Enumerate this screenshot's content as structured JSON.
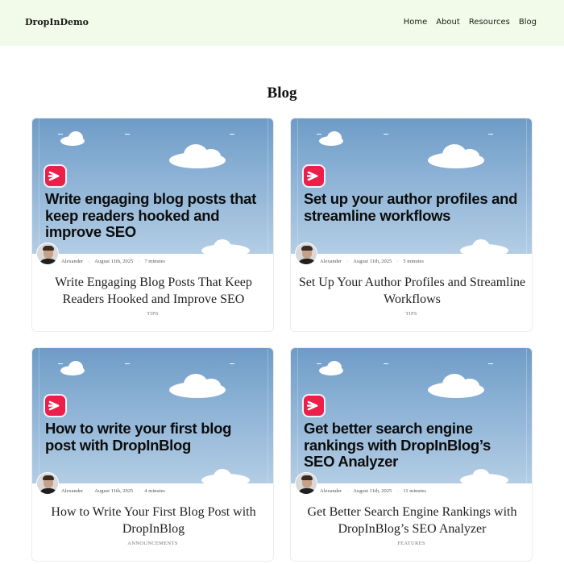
{
  "header": {
    "brand": "DropInDemo",
    "nav": [
      "Home",
      "About",
      "Resources",
      "Blog"
    ]
  },
  "page": {
    "title": "Blog"
  },
  "posts": [
    {
      "hero_headline": "Write engaging blog posts that keep readers hooked and improve SEO",
      "author": "Alexander",
      "date": "August 11th, 2025",
      "read_time": "7 minutes",
      "title": "Write Engaging Blog Posts That Keep Readers Hooked and Improve SEO",
      "category": "TIPS"
    },
    {
      "hero_headline": "Set up your author profiles and streamline workflows",
      "author": "Alexander",
      "date": "August 11th, 2025",
      "read_time": "5 minutes",
      "title": "Set Up Your Author Profiles and Streamline Workflows",
      "category": "TIPS"
    },
    {
      "hero_headline": "How to write your first blog post with DropInBlog",
      "author": "Alexander",
      "date": "August 11th, 2025",
      "read_time": "4 minutes",
      "title": "How to Write Your First Blog Post with DropInBlog",
      "category": "ANNOUNCEMENTS"
    },
    {
      "hero_headline": "Get better search engine rankings with DropInBlog’s SEO Analyzer",
      "author": "Alexander",
      "date": "August 11th, 2025",
      "read_time": "11 minutes",
      "title": "Get Better Search Engine Rankings with DropInBlog’s SEO Analyzer",
      "category": "FEATURES"
    }
  ],
  "colors": {
    "header_bg": "#f2fbea",
    "logo_badge": "#ec1f4a",
    "sky_top": "#6e9cc7",
    "sky_bottom": "#b3cde4"
  },
  "icons": {
    "logo": "dropinblog-arrow-logo-icon",
    "avatar": "author-avatar"
  }
}
